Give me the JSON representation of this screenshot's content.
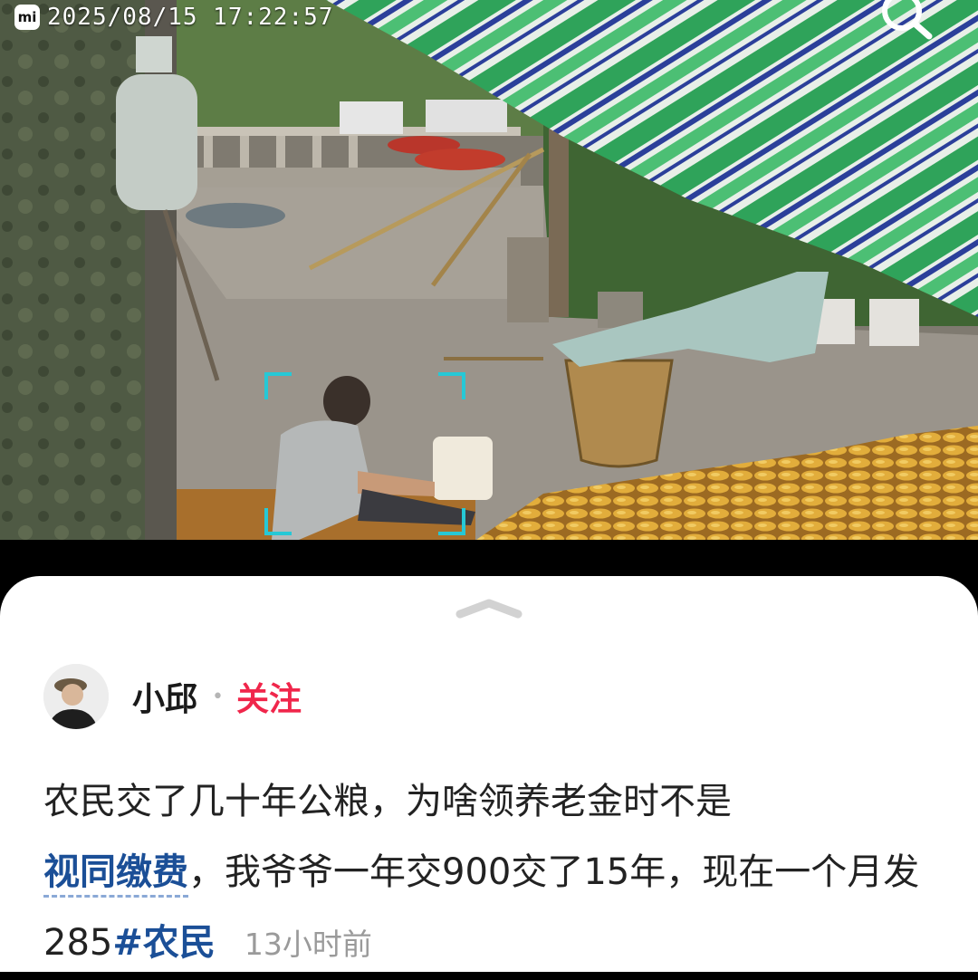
{
  "camera": {
    "brand_icon": "mi",
    "timestamp": "2025/08/15  17:22:57",
    "search_icon": "search-icon"
  },
  "post": {
    "author": {
      "name": "小邱",
      "follow_label": "关注",
      "avatar_icon": "avatar"
    },
    "text_part1": "农民交了几十年公粮，为啥领养老金时不是",
    "link_text": "视同缴费",
    "text_part2": "，我爷爷一年交900交了15年，现在一个月发285",
    "hashtag": "#农民",
    "time_ago": "13小时前"
  },
  "colors": {
    "follow": "#f0264b",
    "link": "#1b4f97"
  }
}
